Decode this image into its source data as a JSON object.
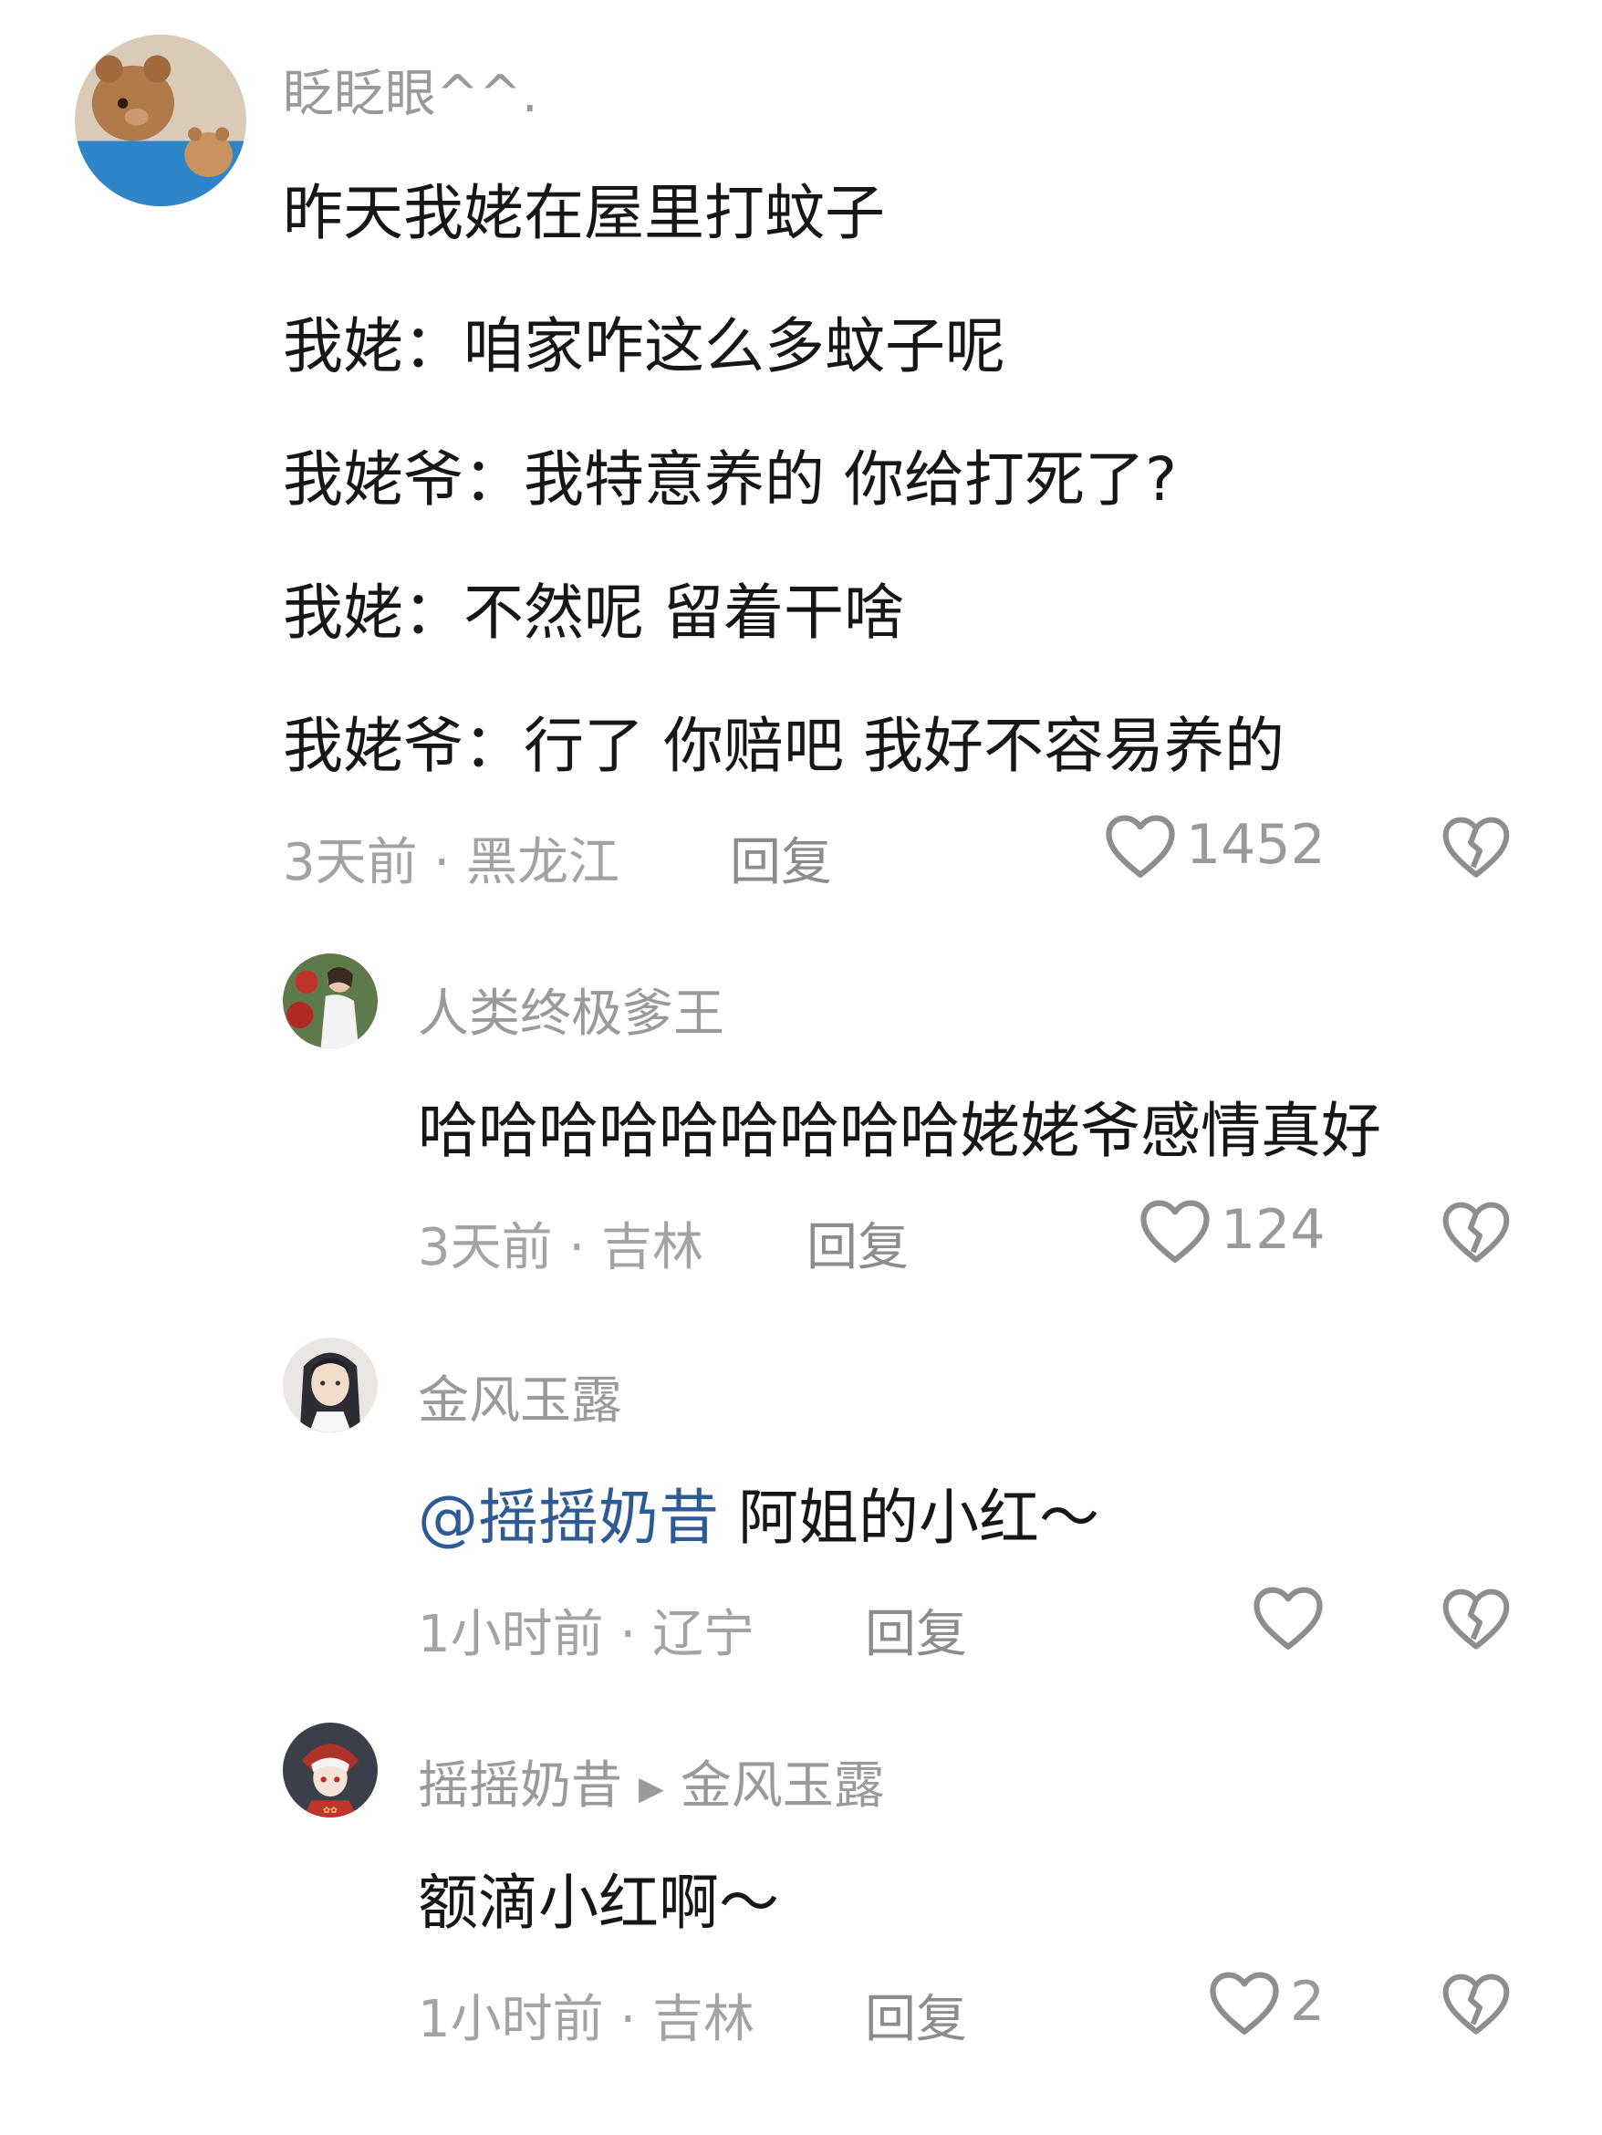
{
  "comments": [
    {
      "username": "眨眨眼^^.",
      "lines": [
        "昨天我姥在屋里打蚊子",
        "我姥：咱家咋这么多蚊子呢",
        "我姥爷：我特意养的 你给打死了?",
        "我姥：不然呢 留着干啥",
        "我姥爷：行了 你赔吧 我好不容易养的"
      ],
      "meta": "3天前 · 黑龙江",
      "reply": "回复",
      "likes": "1452"
    },
    {
      "username": "人类终极爹王",
      "text": "哈哈哈哈哈哈哈哈哈姥姥爷感情真好",
      "meta": "3天前 · 吉林",
      "reply": "回复",
      "likes": "124"
    },
    {
      "username": "金风玉露",
      "mention": "@摇摇奶昔",
      "text": " 阿姐的小红～",
      "meta": "1小时前 · 辽宁",
      "reply": "回复",
      "likes": ""
    },
    {
      "username": "摇摇奶昔",
      "reply_to": "金风玉露",
      "text": "额滴小红啊～",
      "meta": "1小时前 · 吉林",
      "reply": "回复",
      "likes": "2"
    }
  ],
  "icons": {
    "like": "heart-outline-icon",
    "dislike": "broken-heart-icon",
    "reply_arrow": "play-triangle-icon"
  }
}
